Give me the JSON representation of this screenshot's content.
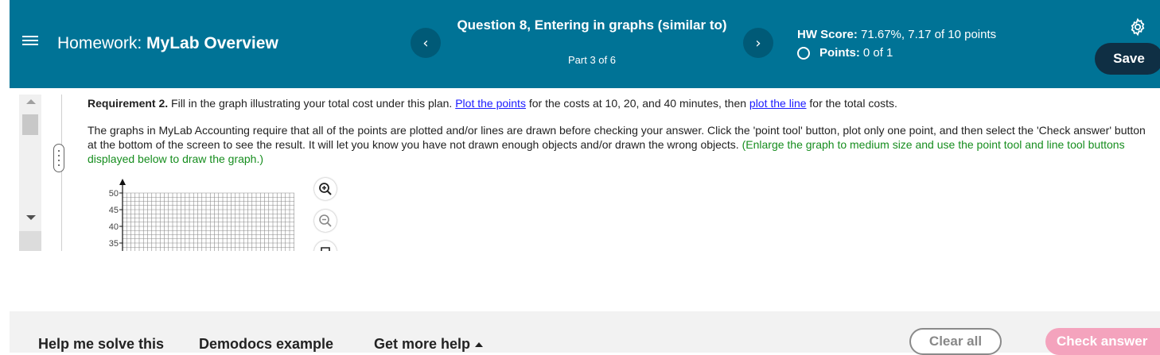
{
  "header": {
    "homework_prefix": "Homework:",
    "homework_name": "MyLab Overview",
    "question_title": "Question 8, Entering in graphs (similar to)",
    "question_part": "Part 3 of 6",
    "prev_label": "‹",
    "next_label": "›",
    "score_label": "HW Score:",
    "score_value": "71.67%, 7.17 of 10 points",
    "points_label": "Points:",
    "points_value": "0 of 1",
    "save_label": "Save"
  },
  "content": {
    "req_bold": "Requirement 2.",
    "req_text1": "Fill in the graph illustrating your total cost under this plan.",
    "req_link1": "Plot the points",
    "req_text2": "for the costs at 10, 20, and 40 minutes, then",
    "req_link2": "plot the line",
    "req_text3": "for the total costs.",
    "para_text": "The graphs in MyLab Accounting require that all of the points are plotted and/or lines are drawn before checking your answer. Click the 'point tool' button, plot only one point, and then select the 'Check answer' button at the bottom of the screen to see the result. It will let you know you have not drawn enough objects and/or drawn the wrong objects.",
    "para_green": "(Enlarge the graph to medium size and use the point tool and line tool buttons displayed below to draw the graph.)",
    "graph": {
      "y_ticks": [
        "50",
        "45",
        "40",
        "35"
      ]
    }
  },
  "footer": {
    "help_label": "Help me solve this",
    "demo_label": "Demodocs example",
    "more_label": "Get more help",
    "clear_label": "Clear all",
    "check_label": "Check answer"
  },
  "colors": {
    "header_bg": "#007396",
    "save_bg": "#0f2f44",
    "link": "#1a1aff",
    "green_text": "#168d1e",
    "check_bg": "#f4a3bd"
  }
}
